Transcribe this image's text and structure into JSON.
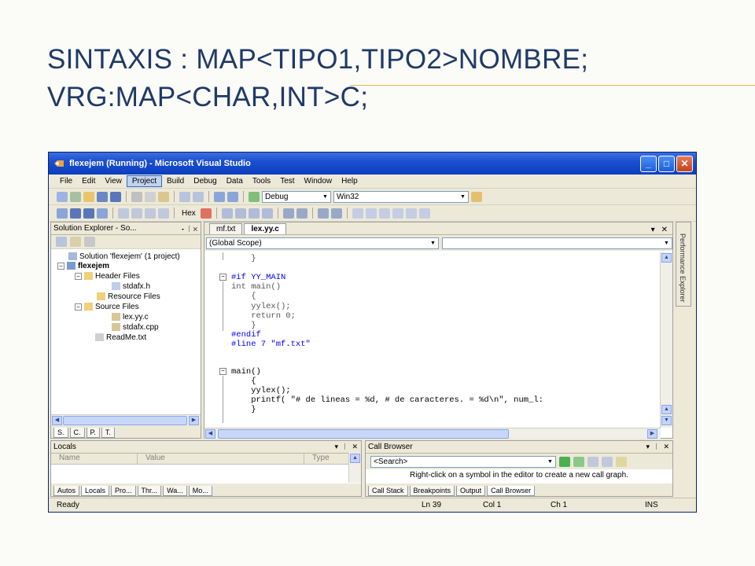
{
  "slide": {
    "title_line1": "SINTAXIS : MAP<TIPO1,TIPO2>NOMBRE;",
    "title_line2": "VRG:MAP<CHAR,INT>C;"
  },
  "window": {
    "title": "flexejem (Running) - Microsoft Visual Studio",
    "minimize": "_",
    "maximize": "□",
    "close": "✕"
  },
  "menu": [
    "File",
    "Edit",
    "View",
    "Project",
    "Build",
    "Debug",
    "Data",
    "Tools",
    "Test",
    "Window",
    "Help"
  ],
  "menu_active": "Project",
  "toolbar": {
    "config": "Debug",
    "platform": "Win32",
    "hex_label": "Hex"
  },
  "solution_explorer": {
    "title": "Solution Explorer - So...",
    "controls": "▾ ᛁ ✕",
    "nodes": [
      {
        "label": "Solution 'flexejem' (1 project)",
        "expander": ""
      },
      {
        "label": "flexejem",
        "expander": "−"
      },
      {
        "label": "Header Files",
        "expander": "−"
      },
      {
        "label": "stdafx.h",
        "expander": ""
      },
      {
        "label": "Resource Files",
        "expander": ""
      },
      {
        "label": "Source Files",
        "expander": "−"
      },
      {
        "label": "lex.yy.c",
        "expander": ""
      },
      {
        "label": "stdafx.cpp",
        "expander": ""
      },
      {
        "label": "ReadMe.txt",
        "expander": ""
      }
    ],
    "tabs": [
      "S.",
      "C.",
      "P.",
      "T."
    ]
  },
  "editor": {
    "tabs": [
      "mf.txt",
      "lex.yy.c"
    ],
    "active_tab": "lex.yy.c",
    "scope": "(Global Scope)",
    "member": "",
    "code": [
      "    }",
      "",
      "#if YY_MAIN",
      "int main()",
      "    {",
      "    yylex();",
      "    return 0;",
      "    }",
      "#endif",
      "#line 7 \"mf.txt\"",
      "",
      "main()",
      "    {",
      "    yylex();",
      "    printf( \"# de lineas = %d, # de caracteres. = %d\\n\", num_l:",
      "    }"
    ]
  },
  "performance_explorer": "Performance Explorer",
  "locals": {
    "title": "Locals",
    "columns": [
      "Name",
      "Value",
      "Type"
    ],
    "tabs": [
      "Autos",
      "Locals",
      "Pro...",
      "Thr...",
      "Wa...",
      "Mo..."
    ]
  },
  "call_browser": {
    "title": "Call Browser",
    "search": "<Search>",
    "hint": "Right-click on a symbol in the editor to create a new call graph.",
    "tabs": [
      "Call Stack",
      "Breakpoints",
      "Output",
      "Call Browser"
    ]
  },
  "status": {
    "state": "Ready",
    "line": "Ln 39",
    "col": "Col 1",
    "ch": "Ch 1",
    "mode": "INS"
  },
  "colors": {
    "title_text": "#1f3a68",
    "accent_line": "#e6b74a",
    "titlebar": "#1c4fd0",
    "keyword": "#0000ff"
  }
}
